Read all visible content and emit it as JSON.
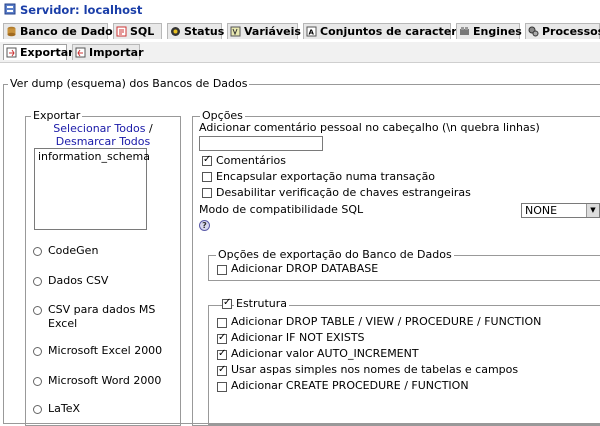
{
  "header": {
    "server": "Servidor: localhost"
  },
  "tabs": {
    "row1": [
      {
        "label": "Banco de Dados",
        "icon": "database-icon"
      },
      {
        "label": "SQL",
        "icon": "sql-icon"
      },
      {
        "label": "Status",
        "icon": "status-icon"
      },
      {
        "label": "Variáveis",
        "icon": "variables-icon"
      },
      {
        "label": "Conjuntos de caracteres",
        "icon": "charset-icon"
      },
      {
        "label": "Engines",
        "icon": "engines-icon"
      },
      {
        "label": "Processos",
        "icon": "processes-icon"
      }
    ],
    "row2": [
      {
        "label": "Exportar",
        "icon": "export-icon",
        "active": true
      },
      {
        "label": "Importar",
        "icon": "import-icon",
        "active": false
      }
    ]
  },
  "main": {
    "legend": "Ver dump (esquema) dos Bancos de Dados",
    "exportar": {
      "legend": "Exportar",
      "select_all": "Selecionar Todos",
      "separator": "/",
      "deselect_all": "Desmarcar Todos",
      "databases": [
        "information_schema"
      ],
      "formats": [
        "CodeGen",
        "Dados CSV",
        "CSV para dados MS Excel",
        "Microsoft Excel 2000",
        "Microsoft Word 2000",
        "LaTeX"
      ]
    },
    "opcoes": {
      "legend": "Opções",
      "comment_label": "Adicionar comentário pessoal no cabeçalho (\\n quebra linhas)",
      "comment_value": "",
      "checks": [
        {
          "label": "Comentários",
          "checked": true
        },
        {
          "label": "Encapsular exportação numa transação",
          "checked": false
        },
        {
          "label": "Desabilitar verificação de chaves estrangeiras",
          "checked": false
        }
      ],
      "compat_label": "Modo de compatibilidade SQL",
      "compat_value": "NONE",
      "help": "?",
      "db_options": {
        "legend": "Opções de exportação do Banco de Dados",
        "checks": [
          {
            "label": "Adicionar DROP DATABASE",
            "checked": false
          }
        ]
      },
      "estrutura": {
        "legend": "Estrutura",
        "legend_checked": true,
        "checks": [
          {
            "label": "Adicionar DROP TABLE / VIEW / PROCEDURE / FUNCTION",
            "checked": false
          },
          {
            "label": "Adicionar IF NOT EXISTS",
            "checked": true
          },
          {
            "label": "Adicionar valor AUTO_INCREMENT",
            "checked": true
          },
          {
            "label": "Usar aspas simples nos nomes de tabelas e campos",
            "checked": true
          },
          {
            "label": "Adicionar CREATE PROCEDURE / FUNCTION",
            "checked": false
          }
        ]
      }
    }
  },
  "colors": {
    "link": "#1a1aa8",
    "title": "#1a3ea8",
    "tab_bg": "#e9e9e9"
  }
}
